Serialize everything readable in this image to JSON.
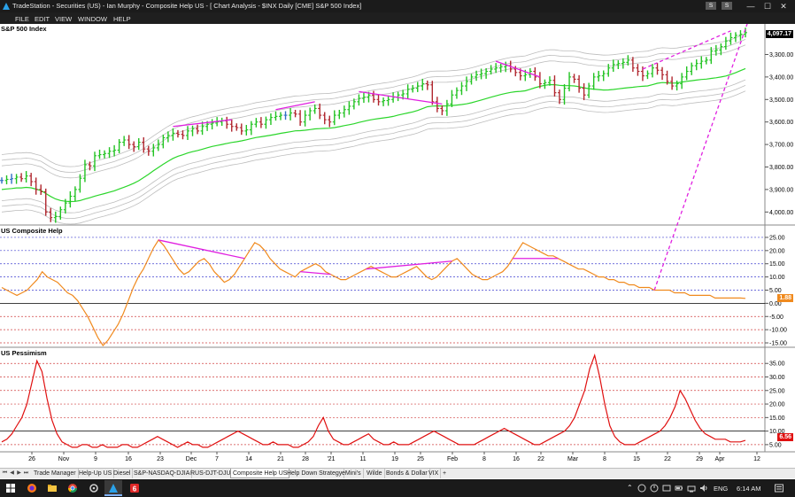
{
  "window": {
    "title": "TradeStation - Securities (US) - Ian Murphy - Composite Help US - [ Chart Analysis - $INX Daily [CME] S&P 500 Index]",
    "buttons": {
      "mini_s1": "S",
      "mini_s2": "S",
      "minimize": "—",
      "maximize": "☐",
      "close": "✕"
    }
  },
  "menu": [
    "FILE",
    "EDIT",
    "VIEW",
    "WINDOW",
    "HELP"
  ],
  "panes": {
    "price": {
      "title": "S&P 500 Index",
      "last_value": "4,097.17",
      "ticks": [
        "4,000.00",
        "3,900.00",
        "3,800.00",
        "3,700.00",
        "3,600.00",
        "3,500.00",
        "3,400.00",
        "3,300.00"
      ]
    },
    "composite": {
      "title": "US Composite Help",
      "last_value": "1.88",
      "ticks": [
        "25.00",
        "20.00",
        "15.00",
        "10.00",
        "5.00",
        "0.00",
        "-5.00",
        "-10.00",
        "-15.00"
      ]
    },
    "pessimism": {
      "title": "US Pessimism",
      "last_value": "6.56",
      "ticks": [
        "35.00",
        "30.00",
        "25.00",
        "20.00",
        "15.00",
        "10.00",
        "5.00"
      ]
    }
  },
  "x_axis_labels": [
    "26",
    "Nov",
    "9",
    "16",
    "23",
    "Dec",
    "7",
    "14",
    "21",
    "28",
    "'21",
    "11",
    "19",
    "25",
    "Feb",
    "8",
    "16",
    "22",
    "Mar",
    "8",
    "15",
    "22",
    "29",
    "Apr",
    "12"
  ],
  "tabs": [
    "Trade Manager",
    "Help-Up US",
    "Diesel",
    "S&P-NASDAQ-DJIA",
    "RUS-DJT-DJU",
    "Composite Help US",
    "Help Down Strategy",
    "eMini's",
    "Wilde",
    "Bonds & Dollar",
    "VIX",
    "+"
  ],
  "active_tab": "Composite Help US",
  "taskbar": {
    "language": "ENG",
    "time": "6:14 AM",
    "pinned_icons": [
      "windows-start-icon",
      "firefox-icon",
      "file-explorer-icon",
      "chrome-icon",
      "settings-icon",
      "tradestation-icon",
      "tradestation-six-icon"
    ]
  },
  "colors": {
    "up_bar": "#22c322",
    "down_bar": "#b0262e",
    "neutral_bar": "#2f6fc4",
    "moving_average": "#2bd62b",
    "envelope": "#bdbdbd",
    "composite_line": "#f08a1e",
    "pessimism_line": "#e01010",
    "divergence": "#e020e0",
    "price_label_bg": "#000000",
    "composite_label_bg": "#f08a1e",
    "pessimism_label_bg": "#e01010"
  },
  "chart_data": [
    {
      "type": "candlestick",
      "title": "S&P 500 Index",
      "ylim": [
        3250,
        4120
      ],
      "ticks": [
        3300,
        3400,
        3500,
        3600,
        3700,
        3800,
        3900,
        4000
      ],
      "last": 4097.17,
      "close": [
        3440,
        3445,
        3448,
        3455,
        3448,
        3460,
        3435,
        3400,
        3390,
        3300,
        3275,
        3280,
        3310,
        3340,
        3370,
        3400,
        3450,
        3510,
        3505,
        3550,
        3555,
        3560,
        3570,
        3575,
        3610,
        3620,
        3600,
        3590,
        3610,
        3580,
        3570,
        3585,
        3600,
        3630,
        3640,
        3650,
        3645,
        3640,
        3660,
        3670,
        3660,
        3680,
        3690,
        3695,
        3700,
        3705,
        3690,
        3680,
        3675,
        3660,
        3665,
        3690,
        3700,
        3690,
        3710,
        3720,
        3725,
        3730,
        3730,
        3740,
        3735,
        3700,
        3730,
        3750,
        3760,
        3730,
        3710,
        3700,
        3730,
        3740,
        3755,
        3770,
        3790,
        3805,
        3810,
        3820,
        3800,
        3790,
        3795,
        3800,
        3810,
        3820,
        3825,
        3845,
        3850,
        3860,
        3870,
        3865,
        3790,
        3760,
        3750,
        3780,
        3820,
        3840,
        3860,
        3880,
        3900,
        3910,
        3915,
        3925,
        3935,
        3940,
        3945,
        3950,
        3935,
        3920,
        3905,
        3910,
        3925,
        3900,
        3870,
        3875,
        3885,
        3830,
        3800,
        3850,
        3900,
        3890,
        3850,
        3820,
        3860,
        3900,
        3905,
        3915,
        3940,
        3955,
        3960,
        3965,
        3975,
        3940,
        3925,
        3905,
        3915,
        3940,
        3930,
        3910,
        3880,
        3860,
        3870,
        3900,
        3925,
        3950,
        3960,
        3970,
        3975,
        4015,
        4020,
        4035,
        4060,
        4075,
        4085,
        4090,
        4097
      ]
    },
    {
      "type": "line",
      "title": "US Composite Help",
      "ylim": [
        -16,
        27
      ],
      "last": 1.88,
      "y": [
        6,
        5,
        4,
        3,
        4,
        5,
        7,
        9,
        12,
        10,
        9,
        8,
        6,
        4,
        3,
        1,
        -2,
        -5,
        -9,
        -13,
        -16,
        -14,
        -11,
        -8,
        -4,
        1,
        6,
        10,
        13,
        17,
        21,
        24,
        22,
        19,
        16,
        13,
        11,
        12,
        14,
        16,
        17,
        15,
        12,
        10,
        8,
        9,
        11,
        14,
        17,
        20,
        23,
        22,
        20,
        17,
        15,
        13,
        12,
        11,
        10,
        12,
        13,
        14,
        15,
        14,
        12,
        11,
        10,
        9,
        9,
        10,
        11,
        12,
        13,
        14,
        13,
        12,
        11,
        10,
        10,
        11,
        12,
        13,
        14,
        12,
        10,
        9,
        10,
        12,
        14,
        16,
        17,
        15,
        13,
        11,
        10,
        9,
        9,
        10,
        11,
        12,
        14,
        17,
        20,
        23,
        22,
        21,
        20,
        19,
        18,
        18,
        17,
        16,
        15,
        14,
        13,
        13,
        12,
        11,
        10,
        10,
        9,
        9,
        8,
        8,
        7,
        7,
        6,
        6,
        6,
        5,
        5,
        5,
        5,
        4,
        4,
        4,
        3,
        3,
        3,
        3,
        3,
        2,
        2,
        2,
        2,
        2,
        2,
        1.88
      ]
    },
    {
      "type": "line",
      "title": "US Pessimism",
      "ylim": [
        3,
        39
      ],
      "last": 6.56,
      "y": [
        6,
        7,
        9,
        12,
        15,
        20,
        28,
        36,
        32,
        22,
        14,
        9,
        6,
        5,
        4,
        4,
        5,
        5,
        4,
        4,
        5,
        4,
        4,
        4,
        5,
        5,
        4,
        4,
        5,
        6,
        7,
        8,
        7,
        6,
        5,
        4,
        5,
        6,
        5,
        5,
        4,
        4,
        5,
        6,
        7,
        8,
        9,
        10,
        9,
        8,
        7,
        6,
        5,
        5,
        6,
        5,
        5,
        5,
        4,
        4,
        5,
        6,
        8,
        12,
        15,
        10,
        7,
        6,
        5,
        5,
        6,
        7,
        8,
        9,
        7,
        6,
        5,
        5,
        6,
        5,
        5,
        5,
        6,
        7,
        8,
        9,
        10,
        9,
        8,
        7,
        6,
        5,
        5,
        5,
        5,
        6,
        7,
        8,
        9,
        10,
        11,
        10,
        9,
        8,
        7,
        6,
        5,
        5,
        6,
        7,
        8,
        9,
        10,
        12,
        15,
        20,
        25,
        33,
        38,
        30,
        20,
        12,
        8,
        6,
        5,
        5,
        5,
        6,
        7,
        8,
        9,
        10,
        12,
        15,
        19,
        25,
        22,
        18,
        14,
        11,
        9,
        8,
        7,
        7,
        7,
        6,
        6,
        6,
        6.56
      ]
    }
  ]
}
